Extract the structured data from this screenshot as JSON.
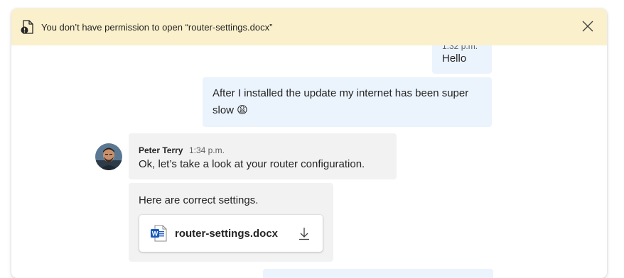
{
  "banner": {
    "message": "You don’t have permission to open “router-settings.docx”",
    "icon": "locked-document-icon",
    "close_icon": "close-icon",
    "background": "#fbf0cc"
  },
  "messages": [
    {
      "id": "m1",
      "from": "me",
      "time": "1:32 p.m.",
      "text": "Hello"
    },
    {
      "id": "m2",
      "from": "me",
      "text": "After I installed the update my internet has been super slow 😩"
    },
    {
      "id": "m3",
      "from": "them",
      "sender": "Peter Terry",
      "time": "1:34 p.m.",
      "text": "Ok, let’s take a look at your router configuration."
    },
    {
      "id": "m4",
      "from": "them",
      "text": "Here are correct settings.",
      "attachment": {
        "name": "router-settings.docx",
        "icon": "word-document-icon",
        "action_icon": "download-icon"
      }
    }
  ],
  "colors": {
    "my_bubble": "#ebf3fc",
    "their_bubble": "#f2f2f2",
    "word_blue": "#185abd"
  }
}
